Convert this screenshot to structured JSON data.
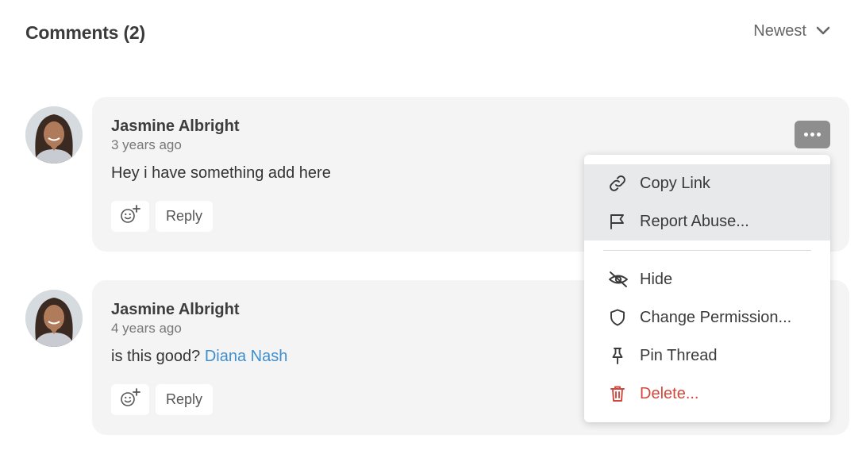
{
  "header": {
    "title": "Comments (2)",
    "sort_label": "Newest",
    "sort_icon": "chevron-down-icon"
  },
  "comments": [
    {
      "author": "Jasmine Albright",
      "time": "3 years ago",
      "text": "Hey i have something add here",
      "reply_label": "Reply",
      "react_icon": "add-reaction-icon"
    },
    {
      "author": "Jasmine Albright",
      "time": "4 years ago",
      "text": "is this good? ",
      "mention": "Diana Nash",
      "reply_label": "Reply",
      "react_icon": "add-reaction-icon"
    }
  ],
  "more_button": {
    "icon": "more-horizontal-icon"
  },
  "menu": {
    "items": [
      {
        "label": "Copy Link",
        "icon": "link-icon"
      },
      {
        "label": "Report Abuse...",
        "icon": "flag-icon"
      },
      {
        "label": "Hide",
        "icon": "eye-off-icon"
      },
      {
        "label": "Change Permission...",
        "icon": "shield-icon"
      },
      {
        "label": "Pin Thread",
        "icon": "pin-icon"
      },
      {
        "label": "Delete...",
        "icon": "trash-icon",
        "danger_color": "#d1473b"
      }
    ]
  },
  "colors": {
    "accent_link": "#3e8ed0",
    "danger": "#d1473b",
    "card_background": "#f4f4f4",
    "menu_highlight": "#e8e9ea",
    "more_button": "#8e8e8e"
  }
}
